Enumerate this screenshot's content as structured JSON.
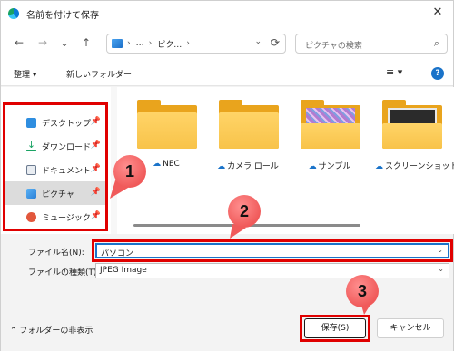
{
  "window": {
    "title": "名前を付けて保存",
    "close_glyph": "✕"
  },
  "nav": {
    "back_glyph": "←",
    "forward_glyph": "→",
    "recent_glyph": "⌄",
    "up_glyph": "↑",
    "address_parts": [
      "›",
      "…",
      "›",
      "ピク…",
      "›"
    ],
    "address_dropdown_glyph": "⌄",
    "refresh_glyph": "⟳",
    "search_placeholder": "ピクチャの検索",
    "search_glyph": "⌕"
  },
  "command": {
    "organize_label": "整理 ▾",
    "new_folder_label": "新しいフォルダー",
    "view_glyph": "≡ ▾",
    "help_glyph": "?"
  },
  "sidebar": {
    "items": [
      {
        "label": "デスクトップ",
        "icon_color": "#2f8ee0",
        "pin": "📌"
      },
      {
        "label": "ダウンロード",
        "icon_color": "#1aa364",
        "pin": "📌"
      },
      {
        "label": "ドキュメント",
        "icon_color": "#6b7a8f",
        "pin": "📌"
      },
      {
        "label": "ピクチャ",
        "icon_color": "#2a7fd6",
        "pin": "📌"
      },
      {
        "label": "ミュージック",
        "icon_color": "#e2573c",
        "pin": "📌"
      }
    ]
  },
  "folders": [
    {
      "label": "NEC",
      "cloud": "☁",
      "has_photo": false
    },
    {
      "label": "カメラ ロール",
      "cloud": "☁",
      "has_photo": false
    },
    {
      "label": "サンプル",
      "cloud": "☁",
      "has_photo": true,
      "photo_color": "#b27bd1"
    },
    {
      "label": "スクリーンショット",
      "cloud": "☁",
      "has_photo": true,
      "photo_color": "#2b2b2b"
    }
  ],
  "form": {
    "filename_label": "ファイル名(N):",
    "filename_value": "パソコン",
    "filetype_label": "ファイルの種類(T):",
    "filetype_value": "JPEG Image",
    "caret_glyph": "⌄"
  },
  "footer": {
    "hide_folders_label": "⌃  フォルダーの非表示",
    "save_label": "保存(S)",
    "cancel_label": "キャンセル"
  },
  "annotations": {
    "badges": [
      "1",
      "2",
      "3"
    ],
    "color": "#e00000"
  }
}
